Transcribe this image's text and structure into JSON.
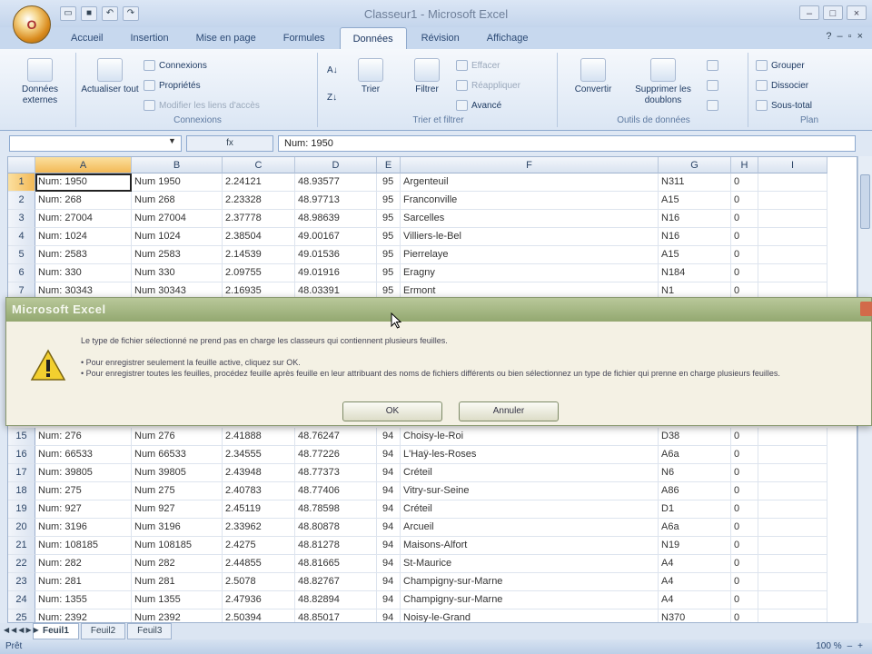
{
  "window": {
    "title": "Classeur1 - Microsoft Excel"
  },
  "office_button": {
    "label": "O"
  },
  "ribbon_tabs": [
    "Accueil",
    "Insertion",
    "Mise en page",
    "Formules",
    "Données",
    "Révision",
    "Affichage"
  ],
  "active_tab": "Données",
  "ribbon": {
    "external_data": "Données externes",
    "refresh_all": "Actualiser tout",
    "connections": "Connexions",
    "properties": "Propriétés",
    "edit_links": "Modifier les liens d'accès",
    "group_connections": "Connexions",
    "sort": "Trier",
    "filter": "Filtrer",
    "clear": "Effacer",
    "reapply": "Réappliquer",
    "advanced": "Avancé",
    "group_sort_filter": "Trier et filtrer",
    "convert": "Convertir",
    "remove_dupes": "Supprimer les doublons",
    "group_data_tools": "Outils de données",
    "group_btn": "Grouper",
    "ungroup_btn": "Dissocier",
    "subtotal": "Sous-total",
    "group_outline": "Plan"
  },
  "name_box": "",
  "formula_bar": {
    "fx": "fx",
    "content": "Num: 1950"
  },
  "columns": [
    "A",
    "B",
    "C",
    "D",
    "E",
    "F",
    "G",
    "H",
    "I"
  ],
  "rows_top": [
    {
      "n": "1",
      "a": "Num: 1950",
      "b": "Num 1950",
      "c": "2.24121",
      "d": "48.93577",
      "e": "95",
      "f": "Argenteuil",
      "g": "N311",
      "h": "0"
    },
    {
      "n": "2",
      "a": "Num: 268",
      "b": "Num 268",
      "c": "2.23328",
      "d": "48.97713",
      "e": "95",
      "f": "Franconville",
      "g": "A15",
      "h": "0"
    },
    {
      "n": "3",
      "a": "Num: 27004",
      "b": "Num 27004",
      "c": "2.37778",
      "d": "48.98639",
      "e": "95",
      "f": "Sarcelles",
      "g": "N16",
      "h": "0"
    },
    {
      "n": "4",
      "a": "Num: 1024",
      "b": "Num 1024",
      "c": "2.38504",
      "d": "49.00167",
      "e": "95",
      "f": "Villiers-le-Bel",
      "g": "N16",
      "h": "0"
    },
    {
      "n": "5",
      "a": "Num: 2583",
      "b": "Num 2583",
      "c": "2.14539",
      "d": "49.01536",
      "e": "95",
      "f": "Pierrelaye",
      "g": "A15",
      "h": "0"
    },
    {
      "n": "6",
      "a": "Num: 330",
      "b": "Num 330",
      "c": "2.09755",
      "d": "49.01916",
      "e": "95",
      "f": "Eragny",
      "g": "N184",
      "h": "0"
    },
    {
      "n": "7",
      "a": "Num: 30343",
      "b": "Num 30343",
      "c": "2.16935",
      "d": "48.03391",
      "e": "95",
      "f": "Ermont",
      "g": "N1",
      "h": "0"
    }
  ],
  "rows_bottom": [
    {
      "n": "15",
      "a": "Num: 276",
      "b": "Num 276",
      "c": "2.41888",
      "d": "48.76247",
      "e": "94",
      "f": "Choisy-le-Roi",
      "g": "D38",
      "h": "0"
    },
    {
      "n": "16",
      "a": "Num: 66533",
      "b": "Num 66533",
      "c": "2.34555",
      "d": "48.77226",
      "e": "94",
      "f": "L'Haÿ-les-Roses",
      "g": "A6a",
      "h": "0"
    },
    {
      "n": "17",
      "a": "Num: 39805",
      "b": "Num 39805",
      "c": "2.43948",
      "d": "48.77373",
      "e": "94",
      "f": "Créteil",
      "g": "N6",
      "h": "0"
    },
    {
      "n": "18",
      "a": "Num: 275",
      "b": "Num 275",
      "c": "2.40783",
      "d": "48.77406",
      "e": "94",
      "f": "Vitry-sur-Seine",
      "g": "A86",
      "h": "0"
    },
    {
      "n": "19",
      "a": "Num: 927",
      "b": "Num 927",
      "c": "2.45119",
      "d": "48.78598",
      "e": "94",
      "f": "Créteil",
      "g": "D1",
      "h": "0"
    },
    {
      "n": "20",
      "a": "Num: 3196",
      "b": "Num 3196",
      "c": "2.33962",
      "d": "48.80878",
      "e": "94",
      "f": "Arcueil",
      "g": "A6a",
      "h": "0"
    },
    {
      "n": "21",
      "a": "Num: 108185",
      "b": "Num 108185",
      "c": "2.4275",
      "d": "48.81278",
      "e": "94",
      "f": "Maisons-Alfort",
      "g": "N19",
      "h": "0"
    },
    {
      "n": "22",
      "a": "Num: 282",
      "b": "Num 282",
      "c": "2.44855",
      "d": "48.81665",
      "e": "94",
      "f": "St-Maurice",
      "g": "A4",
      "h": "0"
    },
    {
      "n": "23",
      "a": "Num: 281",
      "b": "Num 281",
      "c": "2.5078",
      "d": "48.82767",
      "e": "94",
      "f": "Champigny-sur-Marne",
      "g": "A4",
      "h": "0"
    },
    {
      "n": "24",
      "a": "Num: 1355",
      "b": "Num 1355",
      "c": "2.47936",
      "d": "48.82894",
      "e": "94",
      "f": "Champigny-sur-Marne",
      "g": "A4",
      "h": "0"
    },
    {
      "n": "25",
      "a": "Num: 2392",
      "b": "Num 2392",
      "c": "2.50394",
      "d": "48.85017",
      "e": "94",
      "f": "Noisy-le-Grand",
      "g": "N370",
      "h": "0"
    }
  ],
  "sheet_tabs": [
    "Feuil1",
    "Feuil2",
    "Feuil3"
  ],
  "status": {
    "mode": "Prêt",
    "zoom": "100 %"
  },
  "dialog": {
    "title": "Microsoft Excel",
    "line1": "Le type de fichier sélectionné ne prend pas en charge les classeurs qui contiennent plusieurs feuilles.",
    "line2": "• Pour enregistrer seulement la feuille active, cliquez sur OK.",
    "line3": "• Pour enregistrer toutes les feuilles, procédez feuille après feuille en leur attribuant des noms de fichiers différents ou bien sélectionnez un type de fichier qui prenne en charge plusieurs feuilles.",
    "ok": "OK",
    "cancel": "Annuler"
  }
}
